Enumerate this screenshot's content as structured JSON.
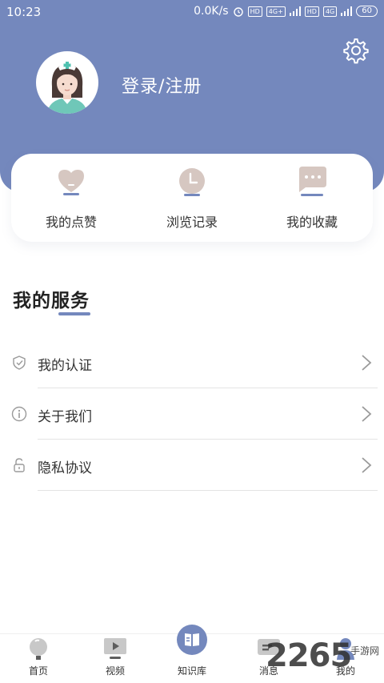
{
  "status_bar": {
    "time": "10:23",
    "speed": "0.0K/s",
    "hd": "HD",
    "network_1": "4G+",
    "network_2": "4G",
    "battery": "60"
  },
  "profile": {
    "login_label": "登录/注册",
    "avatar_icon": "nurse-avatar-icon"
  },
  "quick_actions": [
    {
      "label": "我的点赞",
      "icon": "heart-icon"
    },
    {
      "label": "浏览记录",
      "icon": "clock-icon"
    },
    {
      "label": "我的收藏",
      "icon": "chat-bubble-icon"
    }
  ],
  "services": {
    "title": "我的服务",
    "items": [
      {
        "label": "我的认证",
        "icon": "shield-icon"
      },
      {
        "label": "关于我们",
        "icon": "info-icon"
      },
      {
        "label": "隐私协议",
        "icon": "lock-icon"
      }
    ]
  },
  "tab_bar": {
    "tabs": [
      {
        "label": "首页",
        "icon": "home-icon"
      },
      {
        "label": "视频",
        "icon": "video-icon"
      },
      {
        "label": "知识库",
        "icon": "book-icon"
      },
      {
        "label": "消息",
        "icon": "message-icon"
      },
      {
        "label": "我的",
        "icon": "user-icon"
      }
    ]
  },
  "watermark": {
    "number": "2265",
    "text": "手游网"
  },
  "colors": {
    "primary": "#7488bd",
    "icon_tint": "#d6c7c1",
    "text": "#333333",
    "background": "#ffffff"
  }
}
